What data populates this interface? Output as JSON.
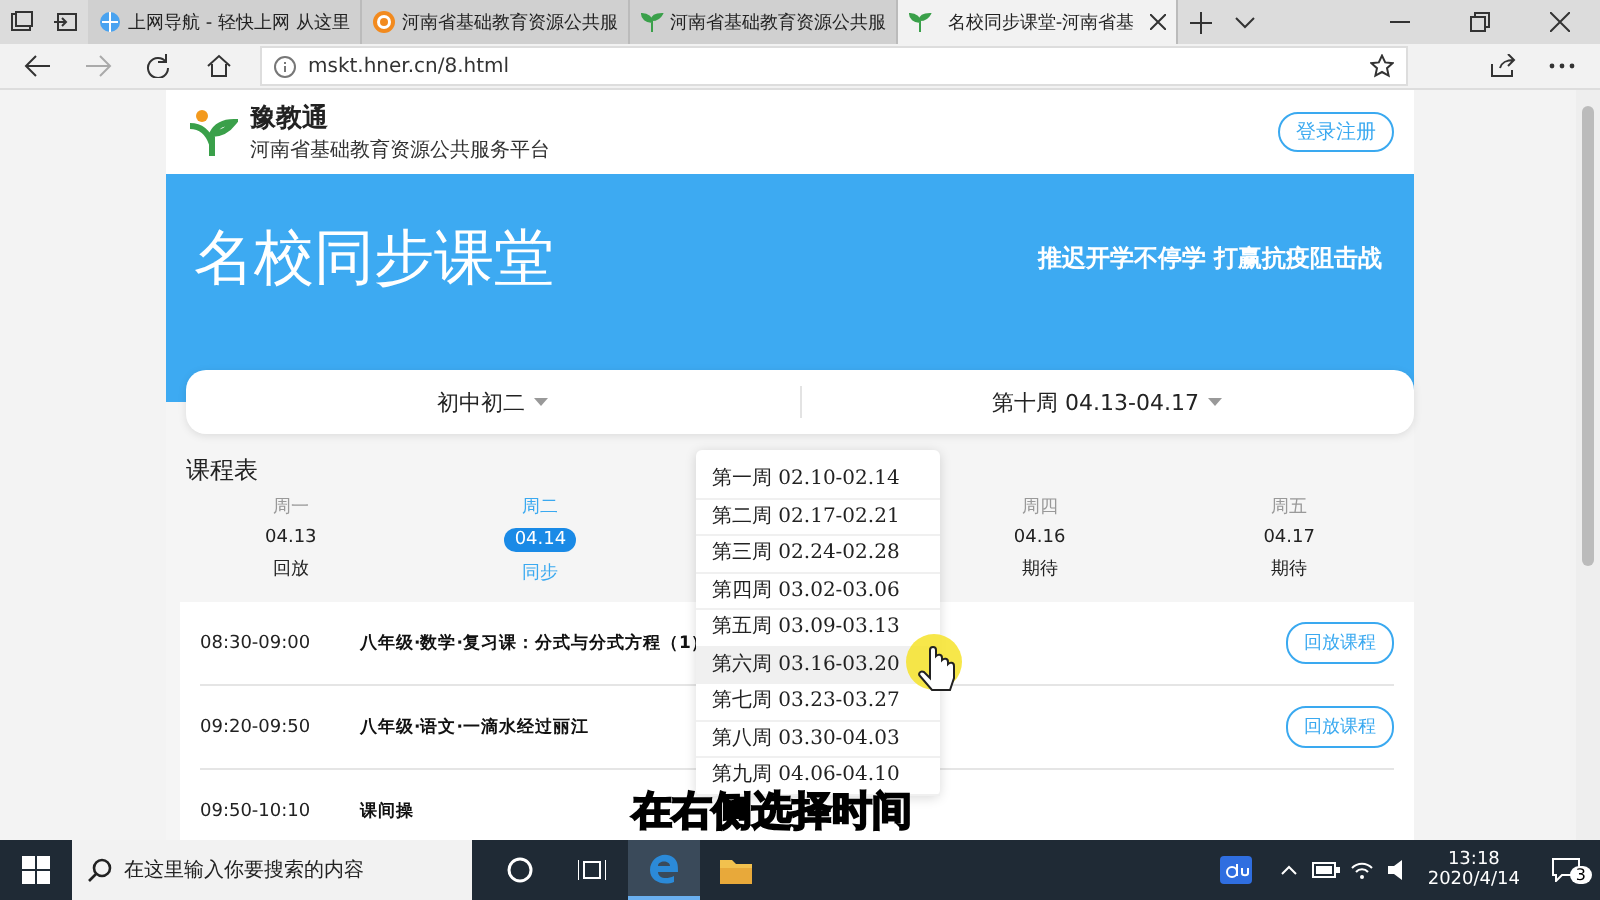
{
  "browser": {
    "tabs": [
      {
        "title": "上网导航 - 轻快上网 从这里",
        "kind": "globe",
        "selected": false
      },
      {
        "title": "河南省基础教育资源公共服",
        "kind": "badge",
        "selected": false
      },
      {
        "title": "河南省基础教育资源公共服",
        "kind": "sprout",
        "selected": false
      },
      {
        "title": "名校同步课堂-河南省基",
        "kind": "sprout",
        "selected": true
      }
    ],
    "url": "mskt.hner.cn/8.html"
  },
  "header": {
    "logo_name": "豫教通",
    "logo_subtitle": "河南省基础教育资源公共服务平台",
    "login_button": "登录注册"
  },
  "banner": {
    "title": "名校同步课堂",
    "slogan": "推迟开学不停学 打赢抗疫阻击战"
  },
  "selectors": [
    {
      "label": "初中初二"
    },
    {
      "label": "第十周 04.13-04.17"
    }
  ],
  "schedule": {
    "title": "课程表",
    "days": [
      {
        "weekday": "周一",
        "date": "04.13",
        "status": "回放",
        "selected": false
      },
      {
        "weekday": "周二",
        "date": "04.14",
        "status": "同步",
        "selected": true
      },
      {
        "weekday": "周四",
        "date": "04.16",
        "status": "期待",
        "selected": false
      },
      {
        "weekday": "周五",
        "date": "04.17",
        "status": "期待",
        "selected": false
      }
    ],
    "lessons": [
      {
        "time": "08:30-09:00",
        "title": "八年级·数学·复习课：分式与分式方程（1）",
        "button": "回放课程"
      },
      {
        "time": "09:20-09:50",
        "title": "八年级·语文·一滴水经过丽江",
        "button": "回放课程"
      },
      {
        "time": "09:50-10:10",
        "title": "课间操"
      }
    ]
  },
  "week_dropdown": [
    {
      "label": "第一周 02.10-02.14",
      "hovered": false
    },
    {
      "label": "第二周 02.17-02.21",
      "hovered": false
    },
    {
      "label": "第三周 02.24-02.28",
      "hovered": false
    },
    {
      "label": "第四周 03.02-03.06",
      "hovered": false
    },
    {
      "label": "第五周 03.09-03.13",
      "hovered": false
    },
    {
      "label": "第六周 03.16-03.20",
      "hovered": true
    },
    {
      "label": "第七周 03.23-03.27",
      "hovered": false
    },
    {
      "label": "第八周 03.30-04.03",
      "hovered": false
    },
    {
      "label": "第九周 04.06-04.10",
      "hovered": false
    }
  ],
  "caption": "在右侧选择时间",
  "taskbar": {
    "search_placeholder": "在这里输入你要搜索的内容",
    "time": "13:18",
    "date": "2020/4/14",
    "notification_count": "3"
  }
}
